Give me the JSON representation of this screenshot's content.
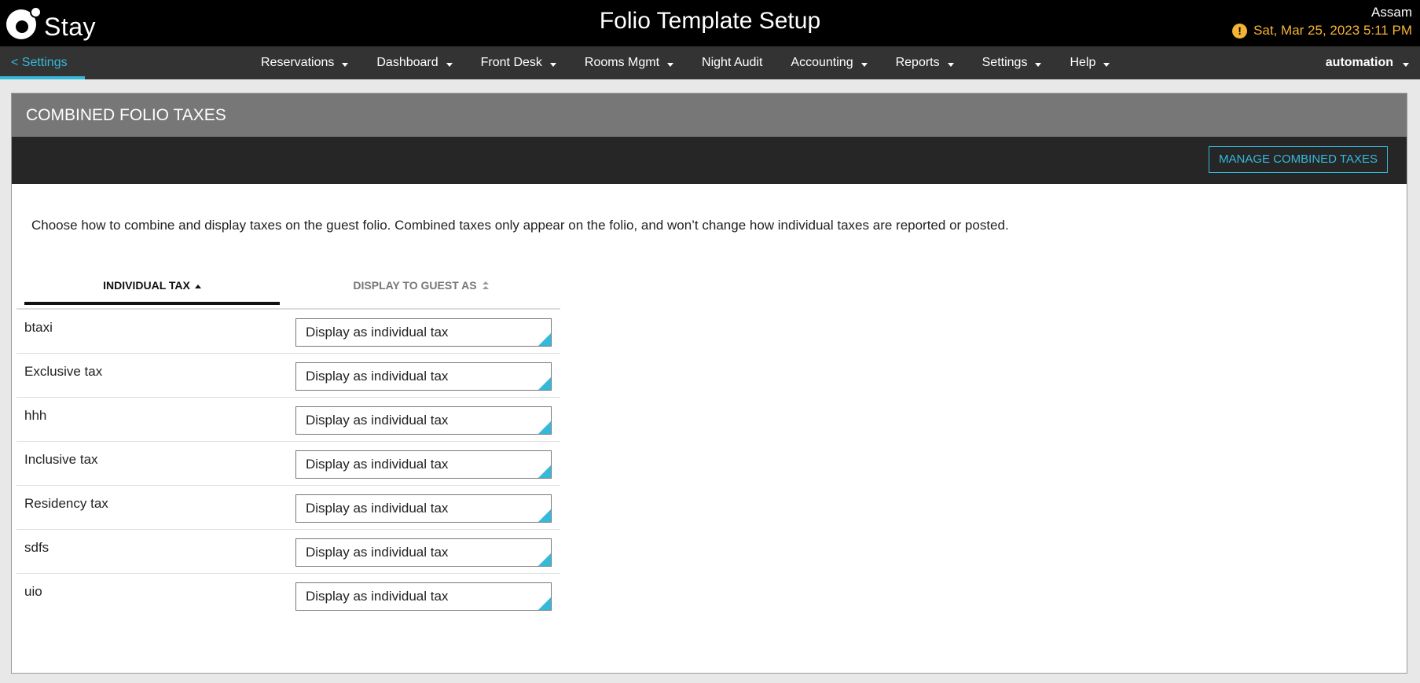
{
  "app": {
    "logo_text": "Stay",
    "title": "Folio Template Setup",
    "user": "Assam",
    "datetime": "Sat, Mar 25, 2023 5:11 PM",
    "warning_icon": "!"
  },
  "nav": {
    "back_label": "< Settings",
    "items": [
      {
        "label": "Reservations",
        "has_caret": true
      },
      {
        "label": "Dashboard",
        "has_caret": true
      },
      {
        "label": "Front Desk",
        "has_caret": true
      },
      {
        "label": "Rooms Mgmt",
        "has_caret": true
      },
      {
        "label": "Night Audit",
        "has_caret": false
      },
      {
        "label": "Accounting",
        "has_caret": true
      },
      {
        "label": "Reports",
        "has_caret": true
      },
      {
        "label": "Settings",
        "has_caret": true
      },
      {
        "label": "Help",
        "has_caret": true
      }
    ],
    "account": "automation"
  },
  "panel": {
    "header": "COMBINED FOLIO TAXES",
    "manage_button": "MANAGE COMBINED TAXES",
    "intro": "Choose how to combine and display taxes on the guest folio. Combined taxes only appear on the folio, and won’t change how individual taxes are reported or posted."
  },
  "table": {
    "col_individual": "INDIVIDUAL TAX",
    "col_display": "DISPLAY TO GUEST AS",
    "rows": [
      {
        "tax": "btaxi",
        "display": "Display as individual tax"
      },
      {
        "tax": "Exclusive tax",
        "display": "Display as individual tax"
      },
      {
        "tax": "hhh",
        "display": "Display as individual tax"
      },
      {
        "tax": "Inclusive tax",
        "display": "Display as individual tax"
      },
      {
        "tax": "Residency tax",
        "display": "Display as individual tax"
      },
      {
        "tax": "sdfs",
        "display": "Display as individual tax"
      },
      {
        "tax": "uio",
        "display": "Display as individual tax"
      }
    ]
  },
  "colors": {
    "accent": "#34b9da",
    "warning": "#f5b335",
    "topbar": "#000000",
    "navbar": "#333333",
    "panel_header": "#777777",
    "toolbar": "#262626"
  }
}
